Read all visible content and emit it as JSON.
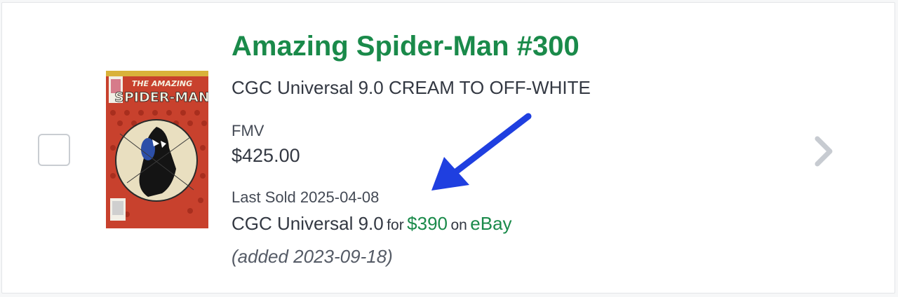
{
  "item": {
    "title": "Amazing Spider-Man #300",
    "grade": "CGC Universal 9.0 CREAM TO OFF-WHITE",
    "fmv_label": "FMV",
    "fmv_value": "$425.00",
    "last_sold": "Last Sold 2025-04-08",
    "sale_grade": "CGC Universal 9.0",
    "sale_for": "for",
    "sale_price": "$390",
    "sale_on": "on",
    "sale_venue": "eBay",
    "added": "(added 2023-09-18)",
    "cover_icon": "comic-cover-thumbnail",
    "cover_text_top": "THE AMAZING",
    "cover_text_main": "SPIDER-MAN"
  },
  "annotation": {
    "arrow_icon": "blue-arrow-icon"
  },
  "colors": {
    "accent_green": "#1a8a4a",
    "text_dark": "#333842",
    "arrow_blue": "#1f3fe0"
  }
}
